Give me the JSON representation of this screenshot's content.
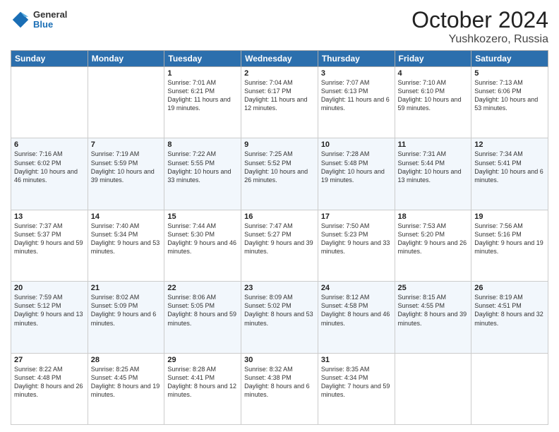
{
  "header": {
    "logo": {
      "general": "General",
      "blue": "Blue"
    },
    "month": "October 2024",
    "location": "Yushkozero, Russia"
  },
  "weekdays": [
    "Sunday",
    "Monday",
    "Tuesday",
    "Wednesday",
    "Thursday",
    "Friday",
    "Saturday"
  ],
  "weeks": [
    [
      {
        "day": "",
        "sunrise": "",
        "sunset": "",
        "daylight": ""
      },
      {
        "day": "",
        "sunrise": "",
        "sunset": "",
        "daylight": ""
      },
      {
        "day": "1",
        "sunrise": "Sunrise: 7:01 AM",
        "sunset": "Sunset: 6:21 PM",
        "daylight": "Daylight: 11 hours and 19 minutes."
      },
      {
        "day": "2",
        "sunrise": "Sunrise: 7:04 AM",
        "sunset": "Sunset: 6:17 PM",
        "daylight": "Daylight: 11 hours and 12 minutes."
      },
      {
        "day": "3",
        "sunrise": "Sunrise: 7:07 AM",
        "sunset": "Sunset: 6:13 PM",
        "daylight": "Daylight: 11 hours and 6 minutes."
      },
      {
        "day": "4",
        "sunrise": "Sunrise: 7:10 AM",
        "sunset": "Sunset: 6:10 PM",
        "daylight": "Daylight: 10 hours and 59 minutes."
      },
      {
        "day": "5",
        "sunrise": "Sunrise: 7:13 AM",
        "sunset": "Sunset: 6:06 PM",
        "daylight": "Daylight: 10 hours and 53 minutes."
      }
    ],
    [
      {
        "day": "6",
        "sunrise": "Sunrise: 7:16 AM",
        "sunset": "Sunset: 6:02 PM",
        "daylight": "Daylight: 10 hours and 46 minutes."
      },
      {
        "day": "7",
        "sunrise": "Sunrise: 7:19 AM",
        "sunset": "Sunset: 5:59 PM",
        "daylight": "Daylight: 10 hours and 39 minutes."
      },
      {
        "day": "8",
        "sunrise": "Sunrise: 7:22 AM",
        "sunset": "Sunset: 5:55 PM",
        "daylight": "Daylight: 10 hours and 33 minutes."
      },
      {
        "day": "9",
        "sunrise": "Sunrise: 7:25 AM",
        "sunset": "Sunset: 5:52 PM",
        "daylight": "Daylight: 10 hours and 26 minutes."
      },
      {
        "day": "10",
        "sunrise": "Sunrise: 7:28 AM",
        "sunset": "Sunset: 5:48 PM",
        "daylight": "Daylight: 10 hours and 19 minutes."
      },
      {
        "day": "11",
        "sunrise": "Sunrise: 7:31 AM",
        "sunset": "Sunset: 5:44 PM",
        "daylight": "Daylight: 10 hours and 13 minutes."
      },
      {
        "day": "12",
        "sunrise": "Sunrise: 7:34 AM",
        "sunset": "Sunset: 5:41 PM",
        "daylight": "Daylight: 10 hours and 6 minutes."
      }
    ],
    [
      {
        "day": "13",
        "sunrise": "Sunrise: 7:37 AM",
        "sunset": "Sunset: 5:37 PM",
        "daylight": "Daylight: 9 hours and 59 minutes."
      },
      {
        "day": "14",
        "sunrise": "Sunrise: 7:40 AM",
        "sunset": "Sunset: 5:34 PM",
        "daylight": "Daylight: 9 hours and 53 minutes."
      },
      {
        "day": "15",
        "sunrise": "Sunrise: 7:44 AM",
        "sunset": "Sunset: 5:30 PM",
        "daylight": "Daylight: 9 hours and 46 minutes."
      },
      {
        "day": "16",
        "sunrise": "Sunrise: 7:47 AM",
        "sunset": "Sunset: 5:27 PM",
        "daylight": "Daylight: 9 hours and 39 minutes."
      },
      {
        "day": "17",
        "sunrise": "Sunrise: 7:50 AM",
        "sunset": "Sunset: 5:23 PM",
        "daylight": "Daylight: 9 hours and 33 minutes."
      },
      {
        "day": "18",
        "sunrise": "Sunrise: 7:53 AM",
        "sunset": "Sunset: 5:20 PM",
        "daylight": "Daylight: 9 hours and 26 minutes."
      },
      {
        "day": "19",
        "sunrise": "Sunrise: 7:56 AM",
        "sunset": "Sunset: 5:16 PM",
        "daylight": "Daylight: 9 hours and 19 minutes."
      }
    ],
    [
      {
        "day": "20",
        "sunrise": "Sunrise: 7:59 AM",
        "sunset": "Sunset: 5:12 PM",
        "daylight": "Daylight: 9 hours and 13 minutes."
      },
      {
        "day": "21",
        "sunrise": "Sunrise: 8:02 AM",
        "sunset": "Sunset: 5:09 PM",
        "daylight": "Daylight: 9 hours and 6 minutes."
      },
      {
        "day": "22",
        "sunrise": "Sunrise: 8:06 AM",
        "sunset": "Sunset: 5:05 PM",
        "daylight": "Daylight: 8 hours and 59 minutes."
      },
      {
        "day": "23",
        "sunrise": "Sunrise: 8:09 AM",
        "sunset": "Sunset: 5:02 PM",
        "daylight": "Daylight: 8 hours and 53 minutes."
      },
      {
        "day": "24",
        "sunrise": "Sunrise: 8:12 AM",
        "sunset": "Sunset: 4:58 PM",
        "daylight": "Daylight: 8 hours and 46 minutes."
      },
      {
        "day": "25",
        "sunrise": "Sunrise: 8:15 AM",
        "sunset": "Sunset: 4:55 PM",
        "daylight": "Daylight: 8 hours and 39 minutes."
      },
      {
        "day": "26",
        "sunrise": "Sunrise: 8:19 AM",
        "sunset": "Sunset: 4:51 PM",
        "daylight": "Daylight: 8 hours and 32 minutes."
      }
    ],
    [
      {
        "day": "27",
        "sunrise": "Sunrise: 8:22 AM",
        "sunset": "Sunset: 4:48 PM",
        "daylight": "Daylight: 8 hours and 26 minutes."
      },
      {
        "day": "28",
        "sunrise": "Sunrise: 8:25 AM",
        "sunset": "Sunset: 4:45 PM",
        "daylight": "Daylight: 8 hours and 19 minutes."
      },
      {
        "day": "29",
        "sunrise": "Sunrise: 8:28 AM",
        "sunset": "Sunset: 4:41 PM",
        "daylight": "Daylight: 8 hours and 12 minutes."
      },
      {
        "day": "30",
        "sunrise": "Sunrise: 8:32 AM",
        "sunset": "Sunset: 4:38 PM",
        "daylight": "Daylight: 8 hours and 6 minutes."
      },
      {
        "day": "31",
        "sunrise": "Sunrise: 8:35 AM",
        "sunset": "Sunset: 4:34 PM",
        "daylight": "Daylight: 7 hours and 59 minutes."
      },
      {
        "day": "",
        "sunrise": "",
        "sunset": "",
        "daylight": ""
      },
      {
        "day": "",
        "sunrise": "",
        "sunset": "",
        "daylight": ""
      }
    ]
  ]
}
